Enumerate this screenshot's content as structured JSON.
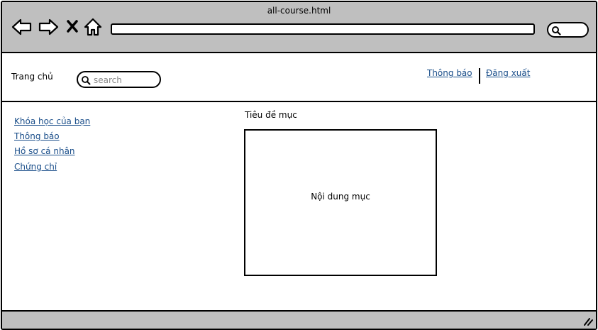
{
  "window": {
    "title": "all-course.html"
  },
  "toolbar": {
    "back_icon": "arrow-left-icon",
    "forward_icon": "arrow-right-icon",
    "stop_icon": "close-icon",
    "home_icon": "home-icon",
    "search_icon": "search-icon",
    "address_value": ""
  },
  "header": {
    "home_label": "Trang chủ",
    "search_placeholder": "search",
    "links": [
      {
        "label": "Thông báo"
      },
      {
        "label": "Đăng xuất"
      }
    ]
  },
  "sidebar": {
    "items": [
      {
        "label": "Khóa học của bạn"
      },
      {
        "label": "Thông báo"
      },
      {
        "label": "Hồ sơ cá nhân"
      },
      {
        "label": "Chứng chỉ"
      }
    ]
  },
  "main": {
    "section_title": "Tiêu đề mục",
    "content": "Nội dung mục"
  },
  "colors": {
    "chrome": "#bfbfbf",
    "link": "#1a4e8a",
    "border": "#000000"
  }
}
